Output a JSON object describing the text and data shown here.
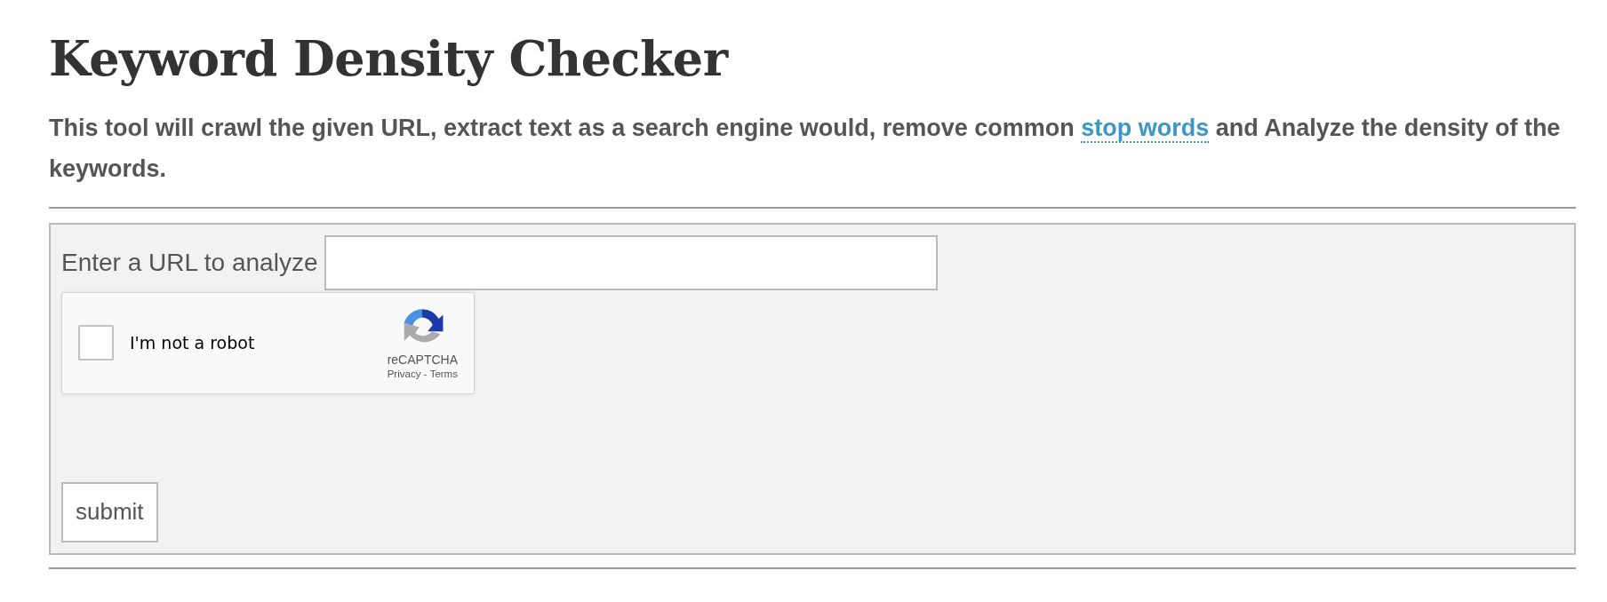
{
  "title": "Keyword Density Checker",
  "intro": {
    "before": "This tool will crawl the given URL, extract text as a search engine would, remove common ",
    "link": "stop words",
    "after": " and Analyze the density of the keywords."
  },
  "form": {
    "url_label": "Enter a URL to analyze",
    "captcha": {
      "label": "I'm not a robot",
      "checked": false,
      "brand": "reCAPTCHA",
      "privacy": "Privacy",
      "separator": " - ",
      "terms": "Terms"
    },
    "submit": "submit"
  }
}
